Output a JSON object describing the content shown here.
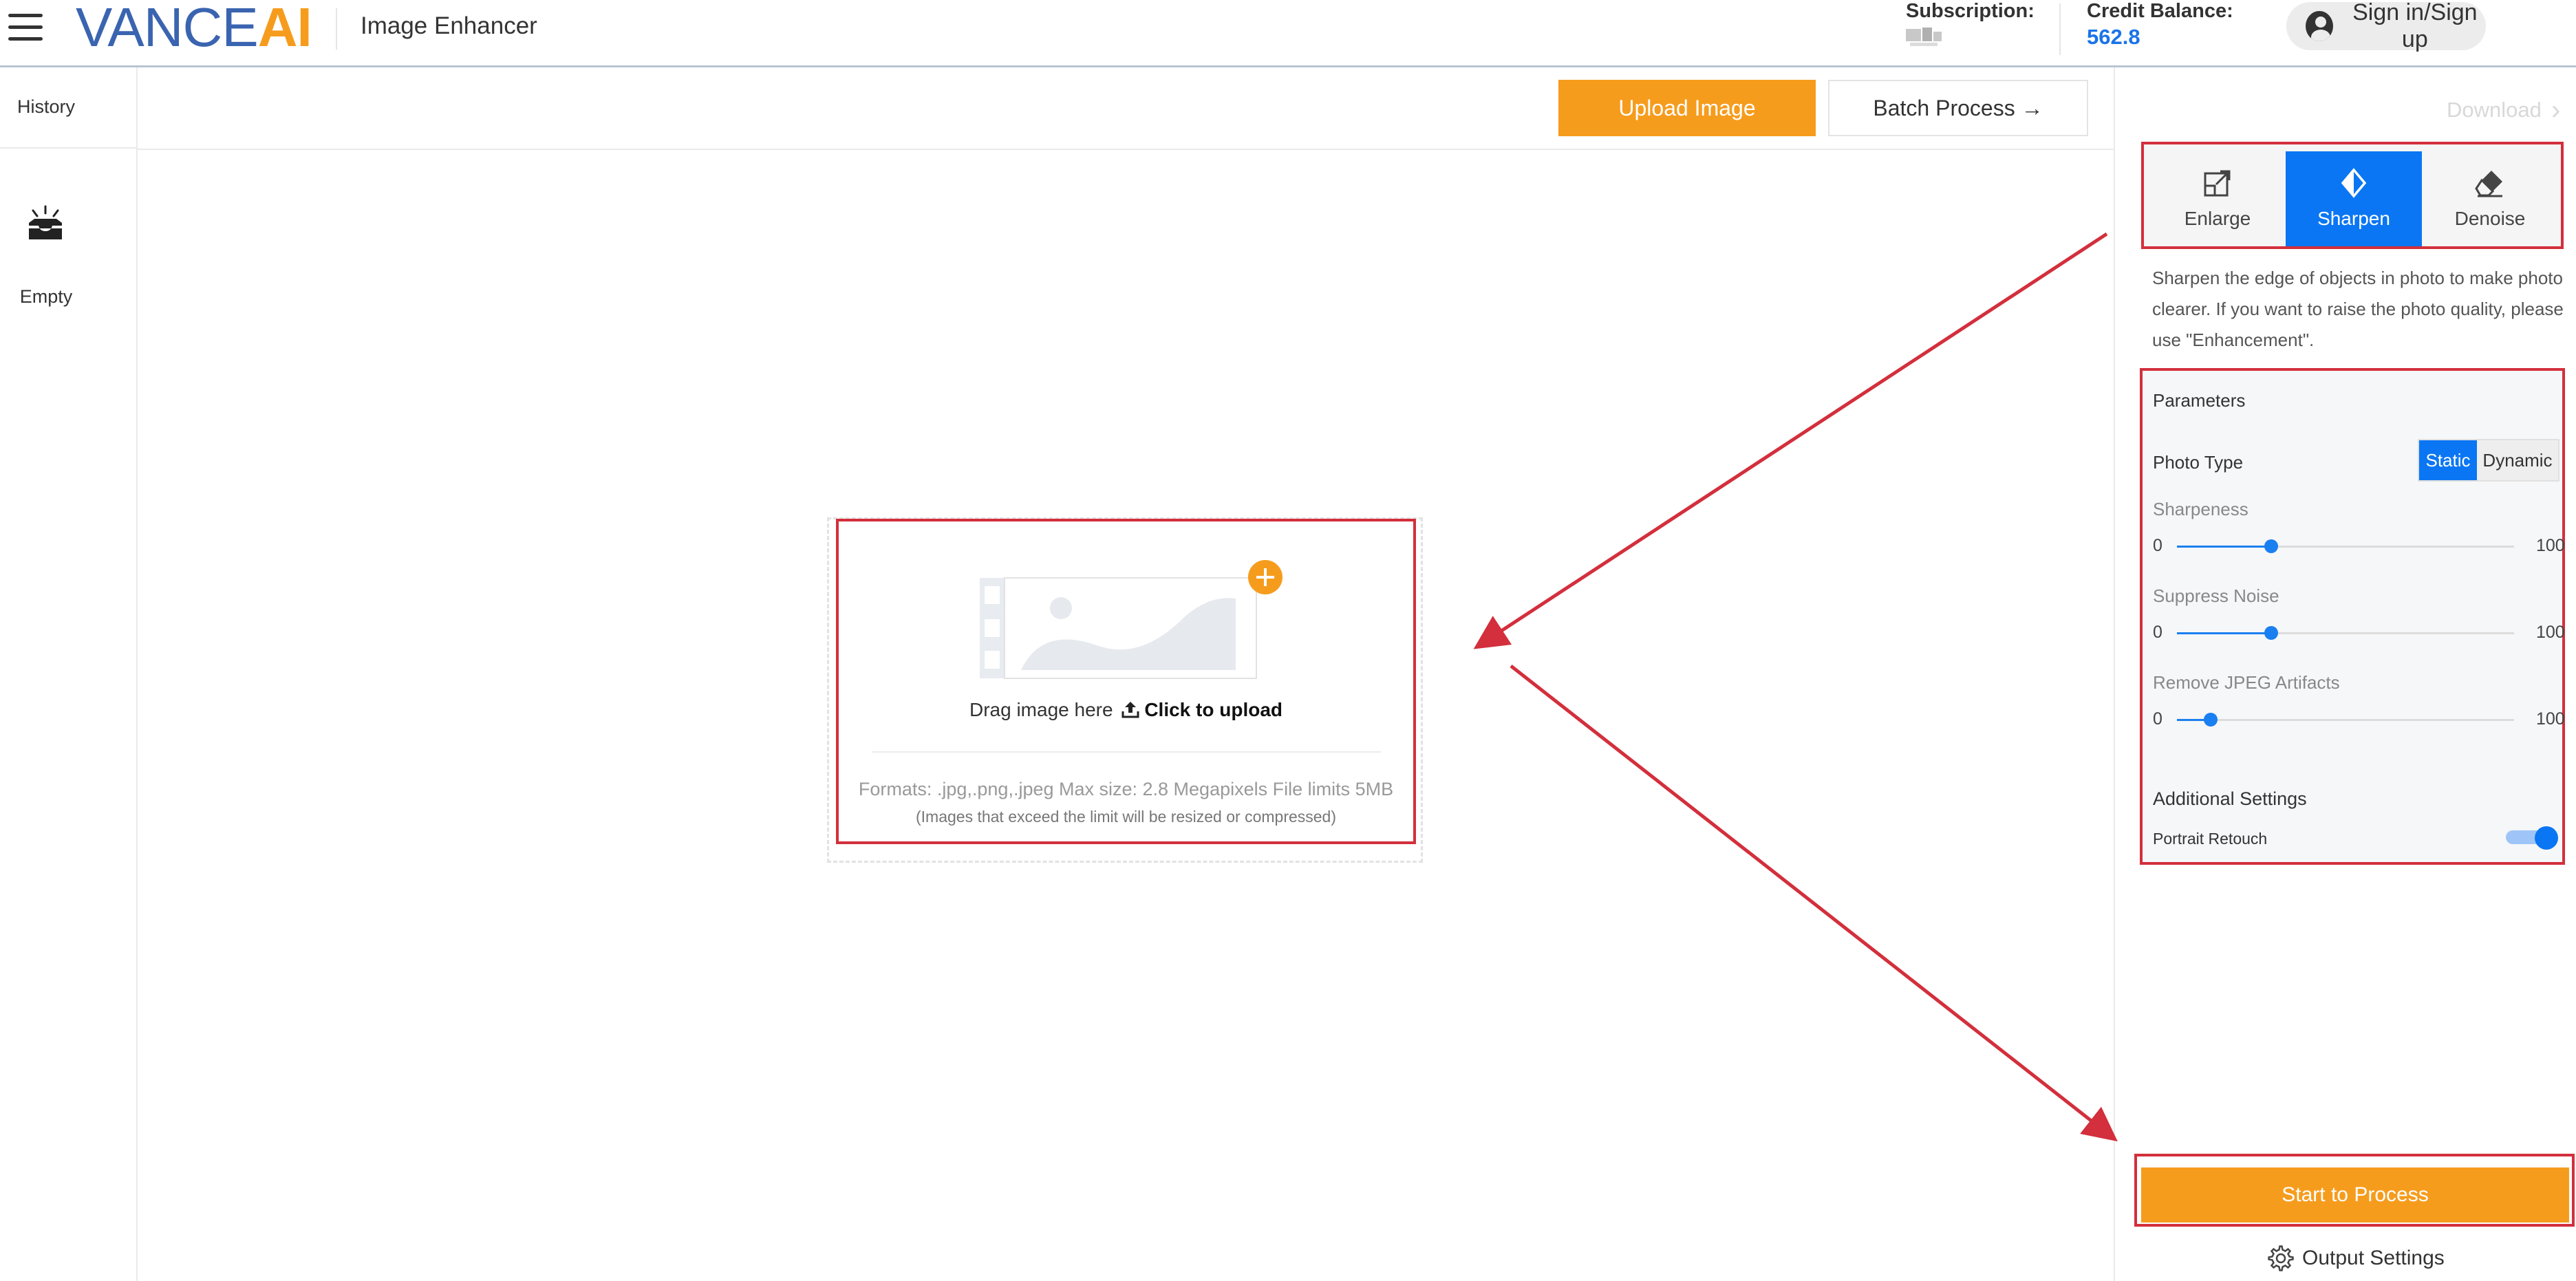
{
  "header": {
    "logo_vance": "VANCE",
    "logo_ai": "AI",
    "app_title": "Image Enhancer",
    "subscription_label": "Subscription:",
    "credit_label": "Credit Balance:",
    "credit_value": "562.8",
    "signin_label": "Sign in/Sign up"
  },
  "sidebar": {
    "history_label": "History",
    "empty_label": "Empty",
    "empty_icon": "inbox-tray-icon"
  },
  "toolbar": {
    "upload_label": "Upload Image",
    "batch_label": "Batch Process →"
  },
  "upload_area": {
    "drag_text": "Drag image here",
    "click_text": "Click to upload",
    "formats_text": "Formats: .jpg,.png,.jpeg Max size: 2.8 Megapixels File limits 5MB",
    "note_text": "(Images that exceed the limit will be resized or compressed)"
  },
  "right_panel": {
    "download_label": "Download",
    "tabs": [
      {
        "label": "Enlarge",
        "icon": "enlarge-icon",
        "active": false
      },
      {
        "label": "Sharpen",
        "icon": "sharpen-icon",
        "active": true
      },
      {
        "label": "Denoise",
        "icon": "eraser-icon",
        "active": false
      }
    ],
    "description": "Sharpen the edge of objects in photo to make photo clearer. If you want to raise the photo quality, please use \"Enhancement\".",
    "params": {
      "title": "Parameters",
      "photo_type_label": "Photo Type",
      "photo_type_options": [
        "Static",
        "Dynamic"
      ],
      "photo_type_selected": "Static",
      "sliders": [
        {
          "label": "Sharpeness",
          "min": "0",
          "max": "100",
          "value": 28
        },
        {
          "label": "Suppress Noise",
          "min": "0",
          "max": "100",
          "value": 28
        },
        {
          "label": "Remove JPEG Artifacts",
          "min": "0",
          "max": "100",
          "value": 10
        }
      ],
      "additional_label": "Additional Settings",
      "portrait_label": "Portrait Retouch",
      "portrait_on": true
    },
    "start_label": "Start to Process",
    "output_label": "Output Settings"
  },
  "colors": {
    "accent_orange": "#f69c1d",
    "accent_blue": "#0a76f3",
    "annotation_red": "#d32f3c"
  }
}
